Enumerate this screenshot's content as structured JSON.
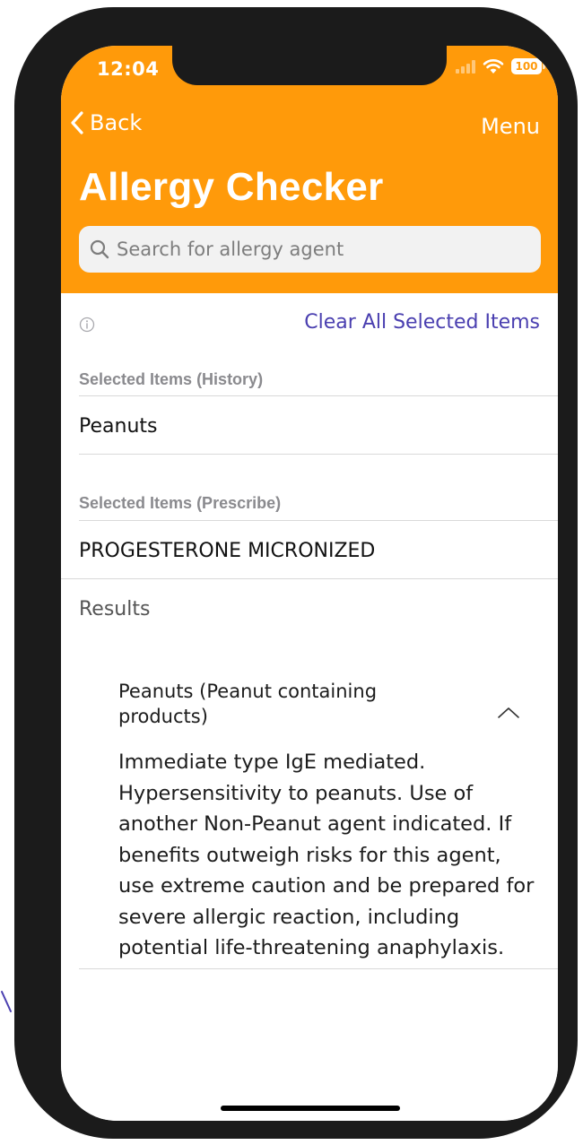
{
  "colors": {
    "accent": "#FF9A0A",
    "link": "#4A3FB0"
  },
  "status_bar": {
    "time": "12:04",
    "battery": "100",
    "icons": [
      "signal-icon",
      "wifi-icon",
      "battery-icon"
    ]
  },
  "nav": {
    "back_label": "Back",
    "menu_label": "Menu",
    "title": "Allergy Checker"
  },
  "search": {
    "placeholder": "Search for allergy agent",
    "value": ""
  },
  "actions": {
    "clear_all_label": "Clear All Selected Items"
  },
  "sections": {
    "history": {
      "header": "Selected Items (History)",
      "items": [
        "Peanuts"
      ]
    },
    "prescribe": {
      "header": "Selected Items (Prescribe)",
      "items": [
        "PROGESTERONE MICRONIZED"
      ]
    },
    "results": {
      "header": "Results",
      "items": [
        {
          "title": "Peanuts (Peanut containing products)",
          "expanded": true,
          "description": "Immediate type IgE mediated. Hypersensitivity to peanuts. Use of another Non-Peanut agent indicated. If benefits outweigh risks for this agent, use extreme caution and be prepared for severe allergic reaction, including potential life-threatening anaphylaxis."
        }
      ]
    }
  }
}
